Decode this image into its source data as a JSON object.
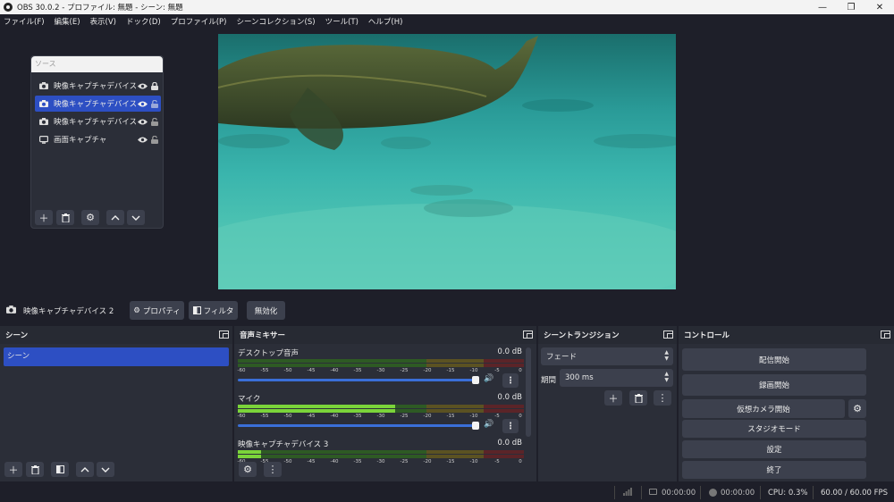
{
  "window": {
    "title": "OBS 30.0.2 - プロファイル: 無題 - シーン: 無題"
  },
  "menu": [
    "ファイル(F)",
    "編集(E)",
    "表示(V)",
    "ドック(D)",
    "プロファイル(P)",
    "シーンコレクション(S)",
    "ツール(T)",
    "ヘルプ(H)"
  ],
  "sources_dock": {
    "title": "ソース",
    "items": [
      {
        "label": "映像キャプチャデバイス",
        "icon": "camera-icon",
        "selected": false
      },
      {
        "label": "映像キャプチャデバイス",
        "icon": "camera-icon",
        "selected": true
      },
      {
        "label": "映像キャプチャデバイス",
        "icon": "camera-icon",
        "selected": false
      },
      {
        "label": "画面キャプチャ",
        "icon": "monitor-icon",
        "selected": false
      }
    ]
  },
  "context_bar": {
    "source_name": "映像キャプチャデバイス 2",
    "properties": "プロパティ",
    "filters": "フィルタ",
    "disable": "無効化"
  },
  "scenes": {
    "title": "シーン",
    "items": [
      "シーン"
    ]
  },
  "mixer": {
    "title": "音声ミキサー",
    "ticks": [
      "-60",
      "-55",
      "-50",
      "-45",
      "-40",
      "-35",
      "-30",
      "-25",
      "-20",
      "-15",
      "-10",
      "-5",
      "0"
    ],
    "channels": [
      {
        "name": "デスクトップ音声",
        "db": "0.0 dB",
        "level": 0.0,
        "volume": 1.0
      },
      {
        "name": "マイク",
        "db": "0.0 dB",
        "level": 0.55,
        "volume": 1.0
      },
      {
        "name": "映像キャプチャデバイス 3",
        "db": "0.0 dB",
        "level": 0.08,
        "volume": 1.0
      }
    ]
  },
  "transitions": {
    "title": "シーントランジション",
    "type": "フェード",
    "duration_label": "期間",
    "duration": "300 ms"
  },
  "controls": {
    "title": "コントロール",
    "start_streaming": "配信開始",
    "start_recording": "録画開始",
    "start_virtual_cam": "仮想カメラ開始",
    "studio_mode": "スタジオモード",
    "settings": "設定",
    "exit": "終了"
  },
  "status": {
    "stream_time": "00:00:00",
    "record_time": "00:00:00",
    "cpu": "CPU: 0.3%",
    "fps": "60.00 / 60.00 FPS"
  },
  "colors": {
    "accent": "#2d4fc3",
    "background": "#1e1f29",
    "panel": "#2b2e38",
    "button": "#3c404d"
  }
}
